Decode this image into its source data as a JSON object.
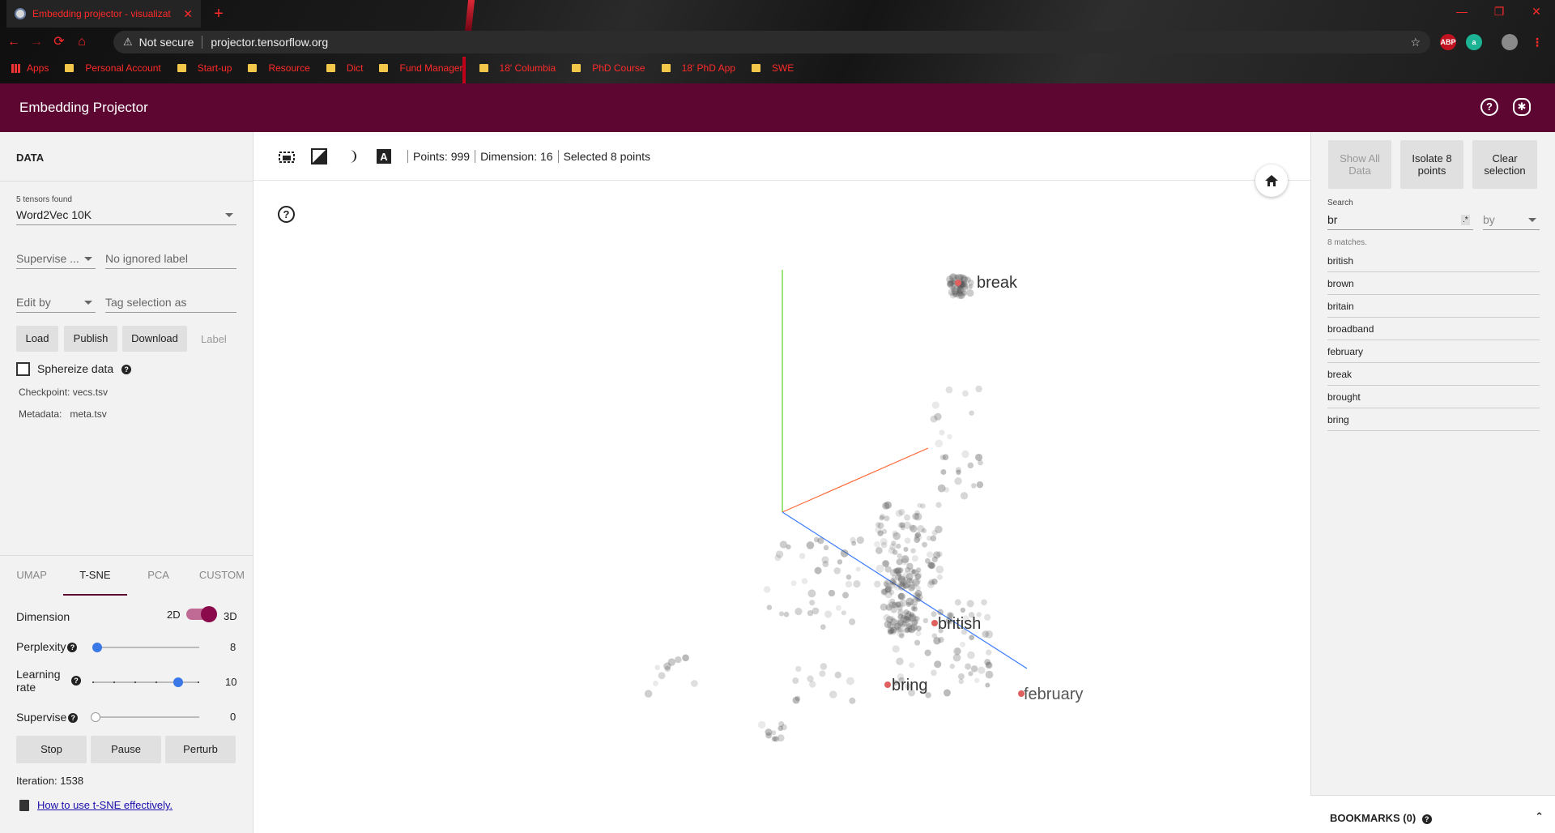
{
  "browser": {
    "tab_title": "Embedding projector - visualizat",
    "url_warning": "Not secure",
    "url": "projector.tensorflow.org",
    "bookmarks": [
      "Apps",
      "Personal Account",
      "Start-up",
      "Resource",
      "Dict",
      "Fund Manager",
      "18' Columbia",
      "PhD Course",
      "18' PhD App",
      "SWE"
    ]
  },
  "app": {
    "title": "Embedding Projector"
  },
  "left": {
    "header": "DATA",
    "tensors_found": "5 tensors found",
    "tensor": "Word2Vec 10K",
    "supervise": "Supervise ...",
    "ignored": "No ignored label",
    "edit_by": "Edit by",
    "tag": "Tag selection as",
    "load": "Load",
    "publish": "Publish",
    "download": "Download",
    "label": "Label",
    "sphereize": "Sphereize data",
    "checkpoint_label": "Checkpoint:",
    "checkpoint": "vecs.tsv",
    "metadata_label": "Metadata:",
    "metadata": "meta.tsv",
    "tabs": [
      "UMAP",
      "T-SNE",
      "PCA",
      "CUSTOM"
    ],
    "dimension": "Dimension",
    "d2": "2D",
    "d3": "3D",
    "perplexity": "Perplexity",
    "perplexity_val": "8",
    "lr1": "Learning",
    "lr2": "rate",
    "lr_val": "10",
    "supervise2": "Supervise",
    "supervise_val": "0",
    "stop": "Stop",
    "pause": "Pause",
    "perturb": "Perturb",
    "iteration": "Iteration: 1538",
    "howto": "How to use t-SNE effectively."
  },
  "center": {
    "points": "Points: 999",
    "dimension": "Dimension: 16",
    "selected": "Selected 8 points",
    "labels": [
      "break",
      "british",
      "bring",
      "february"
    ]
  },
  "right": {
    "show_all": "Show All Data",
    "isolate": "Isolate 8 points",
    "clear": "Clear selection",
    "search_label": "Search",
    "search_value": "br",
    "regex": ".*",
    "by": "by",
    "matches_count": "8 matches.",
    "matches": [
      "british",
      "brown",
      "britain",
      "broadband",
      "february",
      "break",
      "brought",
      "bring"
    ],
    "bookmarks": "BOOKMARKS (0)"
  }
}
